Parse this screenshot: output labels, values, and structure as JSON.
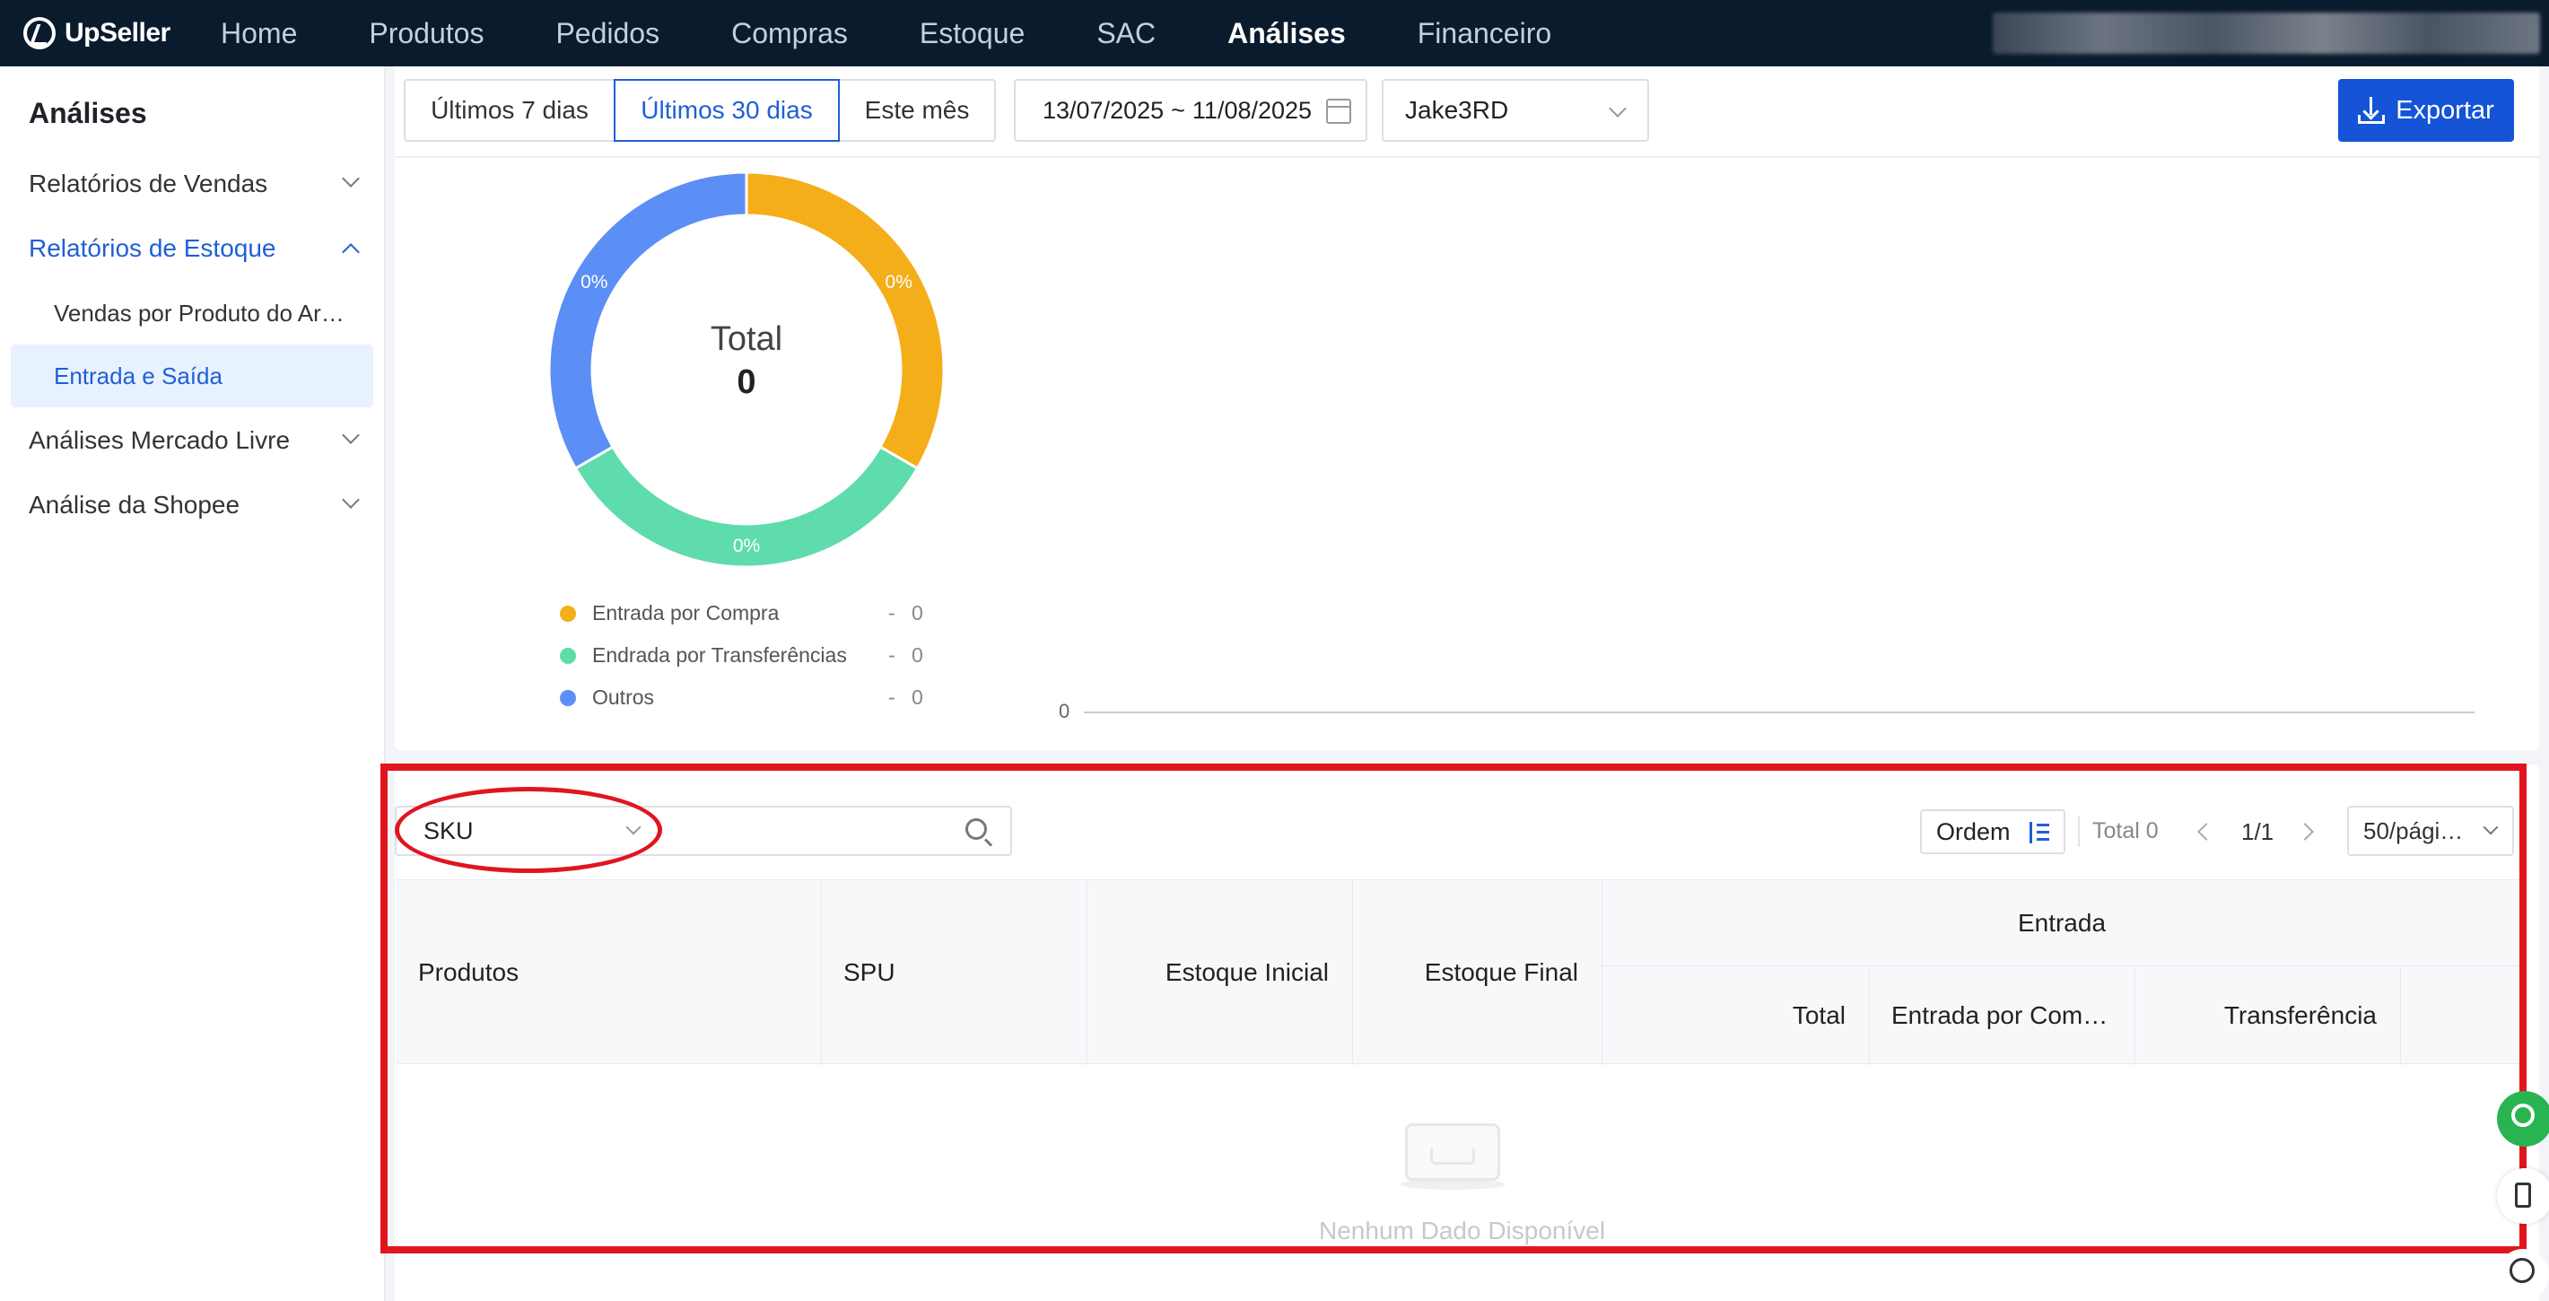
{
  "brand": {
    "name": "UpSeller"
  },
  "nav": {
    "items": [
      "Home",
      "Produtos",
      "Pedidos",
      "Compras",
      "Estoque",
      "SAC",
      "Análises",
      "Financeiro"
    ],
    "active": "Análises"
  },
  "sidebar": {
    "title": "Análises",
    "items": [
      {
        "label": "Relatórios de Vendas"
      },
      {
        "label": "Relatórios de Estoque"
      },
      {
        "label": "Vendas por Produto do Ar…"
      },
      {
        "label": "Entrada e Saída"
      },
      {
        "label": "Análises Mercado Livre"
      },
      {
        "label": "Análise da Shopee"
      }
    ]
  },
  "filters": {
    "periods": [
      "Últimos 7 dias",
      "Últimos 30 dias",
      "Este mês"
    ],
    "active_period": "Últimos 30 dias",
    "date_start": "13/07/2025",
    "date_sep": "~",
    "date_end": "11/08/2025",
    "store": "Jake3RD",
    "export_label": "Exportar"
  },
  "chart_data": {
    "type": "pie",
    "center_label": "Total",
    "center_value": "0",
    "slices": [
      {
        "label": "Entrada por Compra",
        "value": 0,
        "pct": "0%",
        "color": "#f4ae1a"
      },
      {
        "label": "Endrada por Transferências",
        "value": 0,
        "pct": "0%",
        "color": "#5fdcac"
      },
      {
        "label": "Outros",
        "value": 0,
        "pct": "0%",
        "color": "#5b8ff5"
      }
    ],
    "legend_dash": "-",
    "line_axis_zero": "0"
  },
  "table": {
    "search_field": "SKU",
    "search_placeholder": "",
    "order_label": "Ordem",
    "total_label": "Total 0",
    "page": "1/1",
    "per_page": "50/pági…",
    "columns": {
      "produtos": "Produtos",
      "spu": "SPU",
      "estoque_inicial": "Estoque Inicial",
      "estoque_final": "Estoque Final",
      "entrada": "Entrada",
      "total": "Total",
      "entrada_compra": "Entrada por Com…",
      "transferencia": "Transferência"
    },
    "empty_text": "Nenhum Dado Disponível"
  }
}
